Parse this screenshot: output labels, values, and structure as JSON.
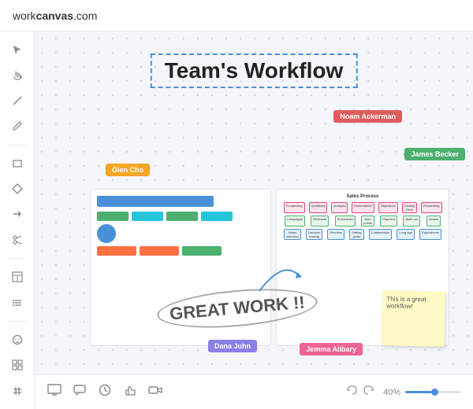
{
  "header": {
    "logo_prefix": "work",
    "logo_bold": "canvas",
    "logo_suffix": ".com"
  },
  "canvas": {
    "title": "Team's Workflow",
    "users": {
      "noam": {
        "name": "Noam Ackerman",
        "color": "#e05c5c"
      },
      "james": {
        "name": "James Becker",
        "color": "#4caf6e"
      },
      "glen": {
        "name": "Glen Cho",
        "color": "#f5a623"
      },
      "dana": {
        "name": "Dana Juhn",
        "color": "#8b7fe8"
      },
      "jemma": {
        "name": "Jemma Alibary",
        "color": "#f06292"
      }
    },
    "great_work": "GREAT WORK !!",
    "sticky_note": "This is a great workflow!",
    "sales_process_title": "Sales Process",
    "zoom_level": "40%"
  },
  "sidebar": {
    "icons": [
      "cursor",
      "hand",
      "line",
      "pen",
      "rectangle",
      "diamond",
      "arrow",
      "scissors",
      "table",
      "list",
      "smiley",
      "grid",
      "hashtag"
    ]
  },
  "toolbar": {
    "zoom": "40%",
    "icons": [
      "monitor",
      "comment",
      "clock",
      "thumb-up",
      "video"
    ]
  }
}
